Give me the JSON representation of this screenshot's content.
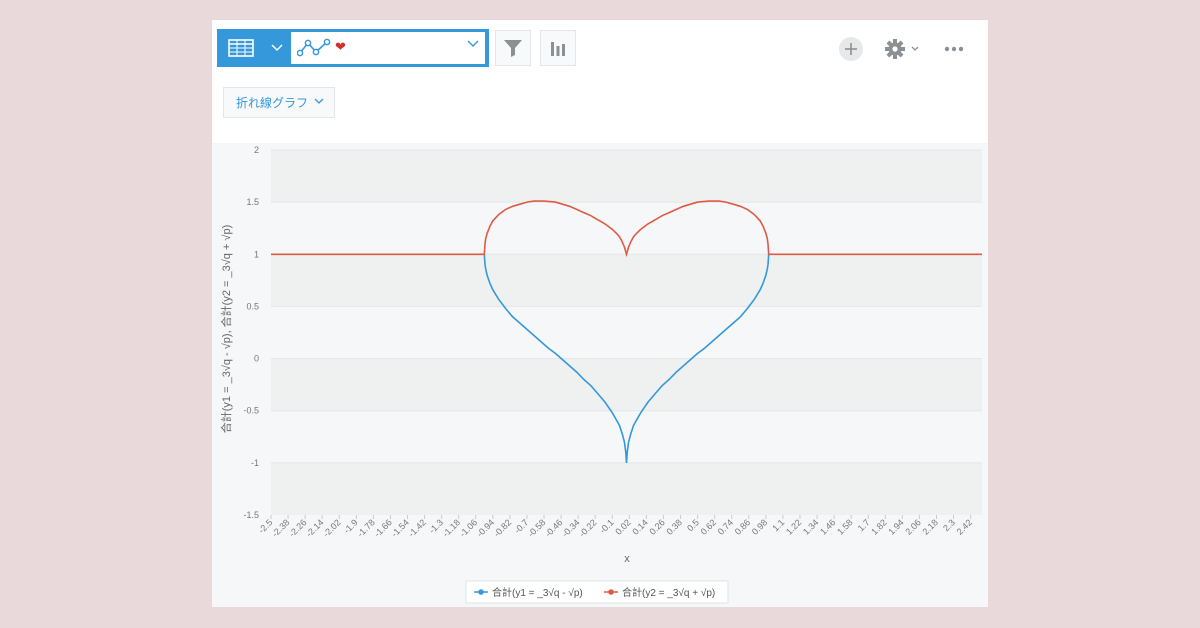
{
  "toolbar": {
    "view_icon": "table-grid-icon",
    "view_dropdown_icon": "chevron-down-icon",
    "graph_icon": "line-graph-icon",
    "heart_icon": "heart-icon",
    "filter_icon": "funnel-icon",
    "chart_icon": "bar-chart-icon",
    "add_icon": "plus-icon",
    "settings_icon": "gear-icon",
    "more_icon": "ellipsis-icon",
    "accent": "#3498db"
  },
  "chart_type_select": {
    "value": "折れ線グラフ"
  },
  "chart_data": {
    "type": "line",
    "xlabel": "x",
    "ylabel": "合計(y1 = _3√q - √p), 合計(y2 = _3√q + √p)",
    "ylim": [
      -1.5,
      2
    ],
    "yticks": [
      "2",
      "1.5",
      "1",
      "0.5",
      "0",
      "-0.5",
      "-1",
      "-1.5"
    ],
    "x_categories": [
      "-2.5",
      "-2.38",
      "-2.26",
      "-2.14",
      "-2.02",
      "-1.9",
      "-1.78",
      "-1.66",
      "-1.54",
      "-1.42",
      "-1.3",
      "-1.18",
      "-1.06",
      "-0.94",
      "-0.82",
      "-0.7",
      "-0.58",
      "-0.46",
      "-0.34",
      "-0.22",
      "-0.1",
      "0.02",
      "0.14",
      "0.26",
      "0.38",
      "0.5",
      "0.62",
      "0.74",
      "0.86",
      "0.98",
      "1.1",
      "1.22",
      "1.34",
      "1.46",
      "1.58",
      "1.7",
      "1.82",
      "1.94",
      "2.06",
      "2.18",
      "2.3",
      "2.42"
    ],
    "xlim": [
      -2.5,
      2.5
    ],
    "grid": true,
    "legend_position": "bottom",
    "series": [
      {
        "name": "合計(y1 = _3√q - √p)",
        "color": "#3498db",
        "points": [
          [
            -1,
            1
          ],
          [
            -0.995,
            0.9
          ],
          [
            -0.99,
            0.86
          ],
          [
            -0.98,
            0.8
          ],
          [
            -0.96,
            0.72
          ],
          [
            -0.94,
            0.66
          ],
          [
            -0.9,
            0.57
          ],
          [
            -0.85,
            0.48
          ],
          [
            -0.8,
            0.4
          ],
          [
            -0.75,
            0.34
          ],
          [
            -0.7,
            0.28
          ],
          [
            -0.65,
            0.22
          ],
          [
            -0.6,
            0.16
          ],
          [
            -0.55,
            0.1
          ],
          [
            -0.5,
            0.05
          ],
          [
            -0.45,
            -0.01
          ],
          [
            -0.4,
            -0.07
          ],
          [
            -0.35,
            -0.13
          ],
          [
            -0.3,
            -0.2
          ],
          [
            -0.25,
            -0.26
          ],
          [
            -0.2,
            -0.34
          ],
          [
            -0.15,
            -0.42
          ],
          [
            -0.1,
            -0.52
          ],
          [
            -0.07,
            -0.59
          ],
          [
            -0.05,
            -0.64
          ],
          [
            -0.03,
            -0.72
          ],
          [
            -0.015,
            -0.8
          ],
          [
            -0.005,
            -0.9
          ],
          [
            0,
            -1
          ],
          [
            0.005,
            -0.9
          ],
          [
            0.015,
            -0.8
          ],
          [
            0.03,
            -0.72
          ],
          [
            0.05,
            -0.64
          ],
          [
            0.07,
            -0.59
          ],
          [
            0.1,
            -0.52
          ],
          [
            0.15,
            -0.42
          ],
          [
            0.2,
            -0.34
          ],
          [
            0.25,
            -0.26
          ],
          [
            0.3,
            -0.2
          ],
          [
            0.35,
            -0.13
          ],
          [
            0.4,
            -0.07
          ],
          [
            0.45,
            -0.01
          ],
          [
            0.5,
            0.05
          ],
          [
            0.55,
            0.1
          ],
          [
            0.6,
            0.16
          ],
          [
            0.65,
            0.22
          ],
          [
            0.7,
            0.28
          ],
          [
            0.75,
            0.34
          ],
          [
            0.8,
            0.4
          ],
          [
            0.85,
            0.48
          ],
          [
            0.9,
            0.57
          ],
          [
            0.94,
            0.66
          ],
          [
            0.96,
            0.72
          ],
          [
            0.98,
            0.8
          ],
          [
            0.99,
            0.86
          ],
          [
            0.995,
            0.9
          ],
          [
            1,
            1
          ]
        ]
      },
      {
        "name": "合計(y2 = _3√q + √p)",
        "color": "#e05a43",
        "points": [
          [
            -2.5,
            1
          ],
          [
            -1,
            1
          ],
          [
            -0.995,
            1.1
          ],
          [
            -0.99,
            1.15
          ],
          [
            -0.98,
            1.2
          ],
          [
            -0.96,
            1.27
          ],
          [
            -0.94,
            1.32
          ],
          [
            -0.9,
            1.38
          ],
          [
            -0.85,
            1.43
          ],
          [
            -0.8,
            1.46
          ],
          [
            -0.75,
            1.48
          ],
          [
            -0.7,
            1.5
          ],
          [
            -0.65,
            1.51
          ],
          [
            -0.58,
            1.51
          ],
          [
            -0.5,
            1.5
          ],
          [
            -0.45,
            1.48
          ],
          [
            -0.4,
            1.46
          ],
          [
            -0.35,
            1.43
          ],
          [
            -0.3,
            1.4
          ],
          [
            -0.25,
            1.37
          ],
          [
            -0.2,
            1.33
          ],
          [
            -0.15,
            1.29
          ],
          [
            -0.1,
            1.24
          ],
          [
            -0.07,
            1.2
          ],
          [
            -0.05,
            1.17
          ],
          [
            -0.03,
            1.12
          ],
          [
            -0.015,
            1.07
          ],
          [
            0,
            1
          ],
          [
            0.015,
            1.07
          ],
          [
            0.03,
            1.12
          ],
          [
            0.05,
            1.17
          ],
          [
            0.07,
            1.2
          ],
          [
            0.1,
            1.24
          ],
          [
            0.15,
            1.29
          ],
          [
            0.2,
            1.33
          ],
          [
            0.25,
            1.37
          ],
          [
            0.3,
            1.4
          ],
          [
            0.35,
            1.43
          ],
          [
            0.4,
            1.46
          ],
          [
            0.45,
            1.48
          ],
          [
            0.5,
            1.5
          ],
          [
            0.58,
            1.51
          ],
          [
            0.65,
            1.51
          ],
          [
            0.7,
            1.5
          ],
          [
            0.75,
            1.48
          ],
          [
            0.8,
            1.46
          ],
          [
            0.85,
            1.43
          ],
          [
            0.9,
            1.38
          ],
          [
            0.94,
            1.32
          ],
          [
            0.96,
            1.27
          ],
          [
            0.98,
            1.2
          ],
          [
            0.99,
            1.15
          ],
          [
            0.995,
            1.1
          ],
          [
            1,
            1
          ],
          [
            2.5,
            1
          ]
        ]
      }
    ]
  }
}
